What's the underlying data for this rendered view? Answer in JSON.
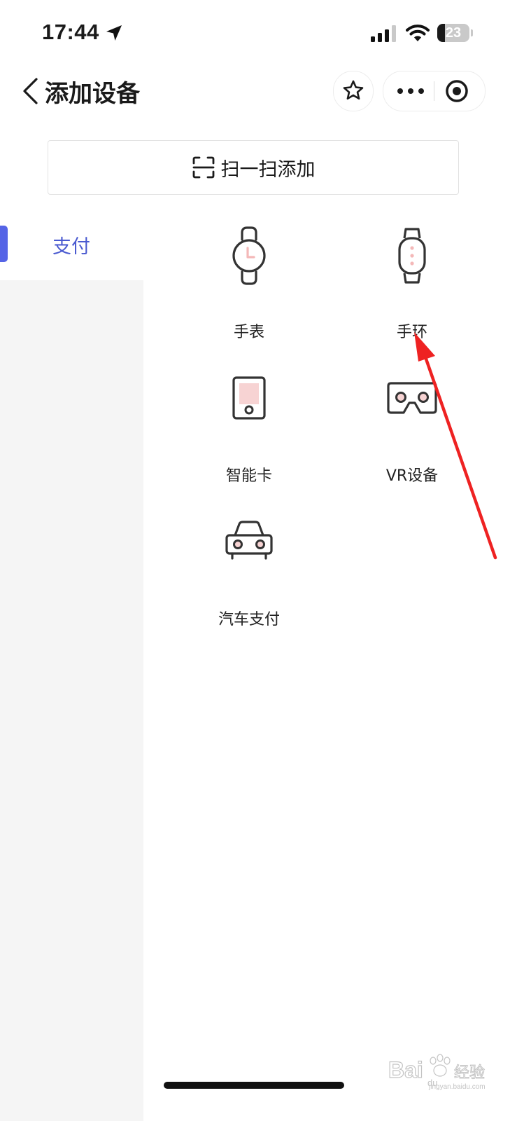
{
  "status_bar": {
    "time": "17:44",
    "battery_level": "23",
    "battery_fraction": 0.23
  },
  "nav": {
    "title": "添加设备",
    "icons": {
      "back": "chevron-left-icon",
      "favorite": "star-icon",
      "more": "more-dots-icon",
      "close": "target-circle-icon"
    }
  },
  "scan": {
    "label": "扫一扫添加",
    "icon": "scan-frame-icon"
  },
  "sidebar": {
    "items": [
      {
        "label": "支付",
        "active": true
      }
    ]
  },
  "devices": [
    {
      "label": "手表",
      "icon": "watch-icon"
    },
    {
      "label": "手环",
      "icon": "band-icon"
    },
    {
      "label": "智能卡",
      "icon": "smart-card-icon"
    },
    {
      "label": "VR设备",
      "icon": "vr-headset-icon"
    },
    {
      "label": "汽车支付",
      "icon": "car-icon"
    }
  ],
  "colors": {
    "accent": "#5564e6",
    "sidebar_bg": "#f5f5f5",
    "icon_stroke": "#333333",
    "icon_pink": "#f7d3d3",
    "annotation_arrow": "#ee2222"
  }
}
